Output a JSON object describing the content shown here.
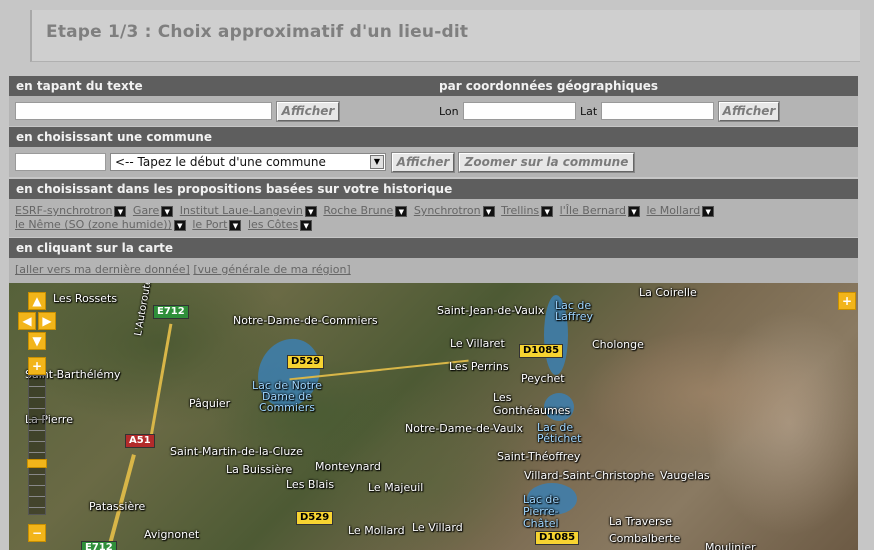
{
  "title": "Etape 1/3 : Choix approximatif d'un lieu-dit",
  "text_search": {
    "heading": "en tapant du texte",
    "value": "",
    "button": "Afficher"
  },
  "coords": {
    "heading": "par coordonnées géographiques",
    "lon_label": "Lon",
    "lon_value": "",
    "lat_label": "Lat",
    "lat_value": "",
    "button": "Afficher"
  },
  "commune": {
    "heading": "en choisissant une commune",
    "input_value": "",
    "select_value": "<-- Tapez le début d'une commune",
    "button_show": "Afficher",
    "button_zoom": "Zoomer sur la commune"
  },
  "history": {
    "heading": "en choisissant dans les propositions basées sur votre historique",
    "items": [
      "ESRF-synchrotron",
      "Gare",
      "Institut Laue-Langevin",
      "Roche Brune",
      "Synchrotron",
      "Trellins",
      "l'Île Bernard",
      "le Mollard",
      "le Nême (SO (zone humide))",
      "le Port",
      "les Côtes"
    ]
  },
  "map_section": {
    "heading": "en cliquant sur la carte",
    "link_last": "[aller vers ma dernière donnée]",
    "link_region": "[vue générale de ma région]"
  },
  "map": {
    "places": [
      "Les Rossets",
      "Notre-Dame-de-Commiers",
      "Saint-Jean-de-Vaulx",
      "La Coirelle",
      "Lac de Laffrey",
      "Le Villaret",
      "Cholonge",
      "Saint-Barthélémy",
      "Les Perrins",
      "Peychet",
      "Lac de Notre Dame de Commiers",
      "Pâquier",
      "Les Gonthéaumes",
      "La Pierre",
      "Notre-Dame-de-Vaulx",
      "Lac de Pétichet",
      "Saint-Martin-de-la-Cluze",
      "La Buissière",
      "Monteynard",
      "Saint-Théoffrey",
      "Villard-Saint-Christophe",
      "Vaugelas",
      "Les Blais",
      "Le Majeuil",
      "Patassière",
      "Lac de Pierre-Châtel",
      "Avignonet",
      "Le Mollard",
      "Le Villard",
      "La Traverse",
      "Combalberte",
      "L'Autoroute du Trièves",
      "Moulinier"
    ],
    "roads": [
      "E712",
      "D529",
      "D1085",
      "A51",
      "D529",
      "D1085",
      "E712"
    ],
    "controls": {
      "pan_up": "▲",
      "pan_left": "◀",
      "pan_right": "▶",
      "pan_down": "▼",
      "zoom_in": "+",
      "zoom_out": "−",
      "expand": "+"
    }
  }
}
